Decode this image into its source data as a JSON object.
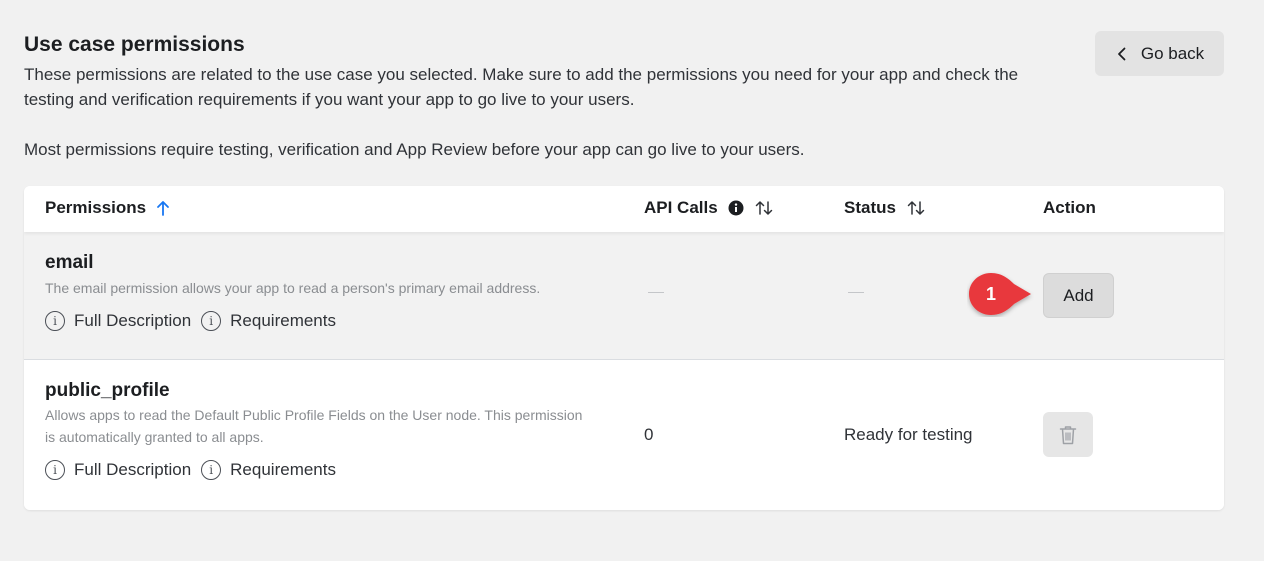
{
  "header": {
    "title": "Use case permissions",
    "description": "These permissions are related to the use case you selected. Make sure to add the permissions you need for your app and check the testing and verification requirements if you want your app to go live to your users.",
    "note": "Most permissions require testing, verification and App Review before your app can go live to your users.",
    "go_back_label": "Go back"
  },
  "table": {
    "columns": {
      "permissions": "Permissions",
      "api_calls": "API Calls",
      "status": "Status",
      "action": "Action"
    },
    "rows": [
      {
        "name": "email",
        "description": "The email permission allows your app to read a person's primary email address.",
        "full_description_label": "Full Description",
        "requirements_label": "Requirements",
        "api_calls": "—",
        "status": "—",
        "action_label": "Add"
      },
      {
        "name": "public_profile",
        "description": "Allows apps to read the Default Public Profile Fields on the User node. This permission is automatically granted to all apps.",
        "full_description_label": "Full Description",
        "requirements_label": "Requirements",
        "api_calls": "0",
        "status": "Ready for testing",
        "action_icon": "trash-icon"
      }
    ]
  },
  "callout": {
    "number": "1",
    "color": "#e8383d"
  },
  "colors": {
    "accent": "#1877f2",
    "background": "#f1f1f1"
  }
}
